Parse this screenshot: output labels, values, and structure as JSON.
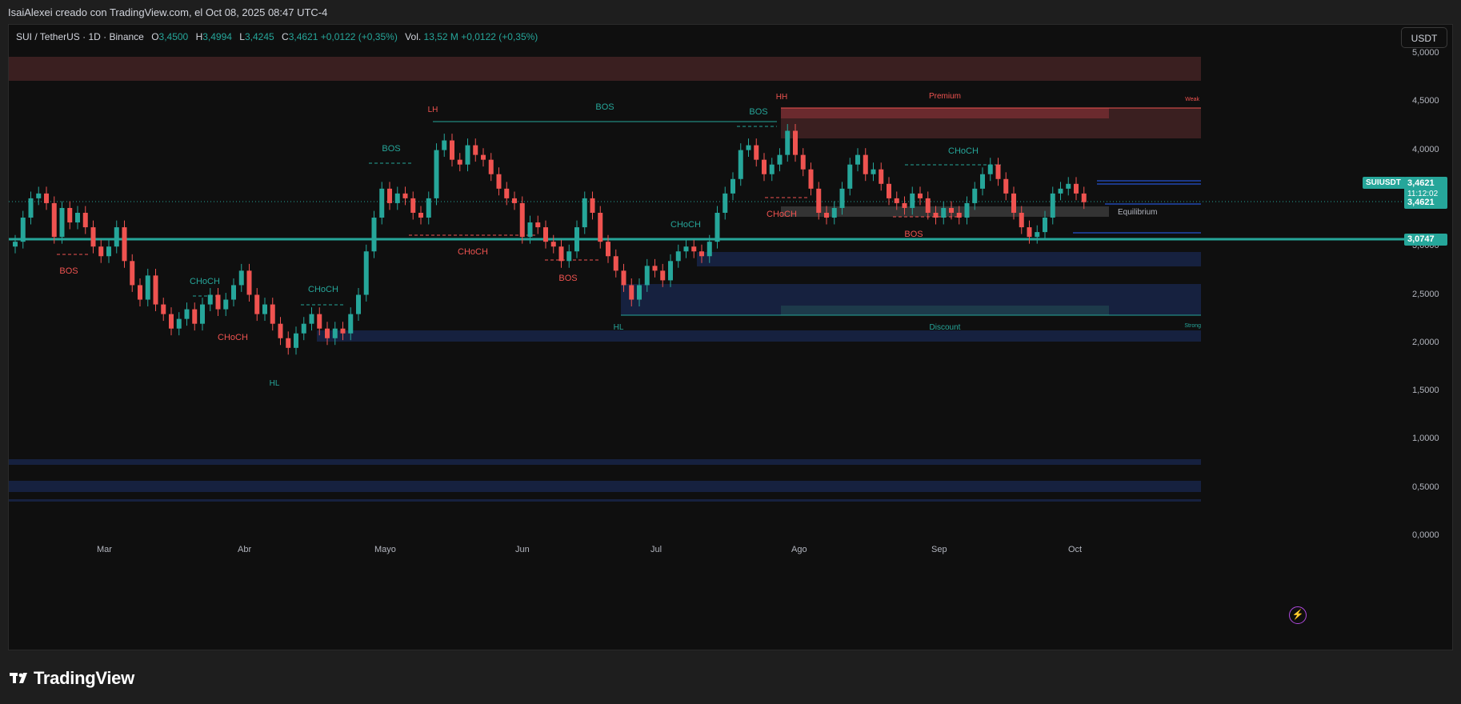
{
  "header": {
    "attribution": "IsaiAlexei creado con TradingView.com, el Oct 08, 2025 08:47 UTC-4"
  },
  "legend": {
    "symbol": "SUI / TetherUS · 1D · Binance",
    "o_label": "O",
    "o_value": "3,4500",
    "h_label": "H",
    "h_value": "3,4994",
    "l_label": "L",
    "l_value": "3,4245",
    "c_label": "C",
    "c_value": "3,4621",
    "change": "+0,0122 (+0,35%)",
    "vol_label": "Vol.",
    "vol_value": "13,52 M",
    "vol_change": "+0,0122 (+0,35%)"
  },
  "currency_button": "USDT",
  "y_axis": {
    "ticks": [
      "5,0000",
      "4,5000",
      "4,0000",
      "3,5000",
      "3,0000",
      "2,5000",
      "2,0000",
      "1,5000",
      "1,0000",
      "0,5000",
      "0,0000"
    ]
  },
  "x_axis": {
    "ticks": [
      "Mar",
      "Abr",
      "Mayo",
      "Jun",
      "Jul",
      "Ago",
      "Sep",
      "Oct"
    ]
  },
  "price_tags": {
    "symbol": "SUIUSDT",
    "last_price": "3,4621",
    "countdown": "11:12:02",
    "price_line": "3,4621",
    "level": "3,0747"
  },
  "annotations": {
    "bos": "BOS",
    "choch": "CHoCH",
    "lh": "LH",
    "hh": "HH",
    "hl": "HL",
    "premium": "Premium",
    "discount": "Discount",
    "equilibrium": "Equilibrium",
    "weak": "Weak",
    "strong": "Strong"
  },
  "colors": {
    "up": "#26a69a",
    "down": "#ef5350",
    "background": "#0f0f0f",
    "accent": "#2962ff"
  },
  "footer": {
    "brand": "TradingView",
    "logo_icon": "tradingview-logo-icon",
    "lightning_icon": "lightning-icon"
  }
}
